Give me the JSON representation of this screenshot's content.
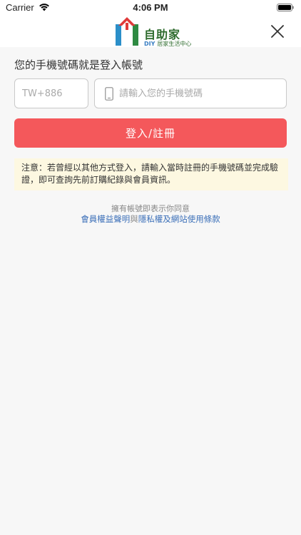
{
  "status_bar": {
    "carrier": "Carrier",
    "time": "4:06 PM"
  },
  "header": {
    "logo_text": "自助家",
    "logo_sub_diy": "DIY",
    "logo_sub_text": "居家生活中心"
  },
  "form": {
    "prompt": "您的手機號碼就是登入帳號",
    "country_code_placeholder": "TW+886",
    "phone_placeholder": "請輸入您的手機號碼",
    "submit_label": "登入/註冊"
  },
  "notice": {
    "text": "注意：若曾經以其他方式登入，請輸入當時註冊的手機號碼並完成驗證，即可查詢先前訂購紀錄與會員資訊。"
  },
  "terms": {
    "agree_text": "擁有帳號即表示你同意",
    "link1": "會員權益聲明",
    "connector": "與",
    "link2": "隱私權及網站使用條款"
  },
  "colors": {
    "accent": "#f4585b",
    "link": "#3b6fb8",
    "notice_bg": "#fdf8e1",
    "logo_green": "#2e6b2d"
  },
  "icons": {
    "wifi": "wifi-icon",
    "battery": "battery-icon",
    "close": "close-icon",
    "phone": "mobile-phone-icon",
    "logo": "house-logo-icon"
  }
}
